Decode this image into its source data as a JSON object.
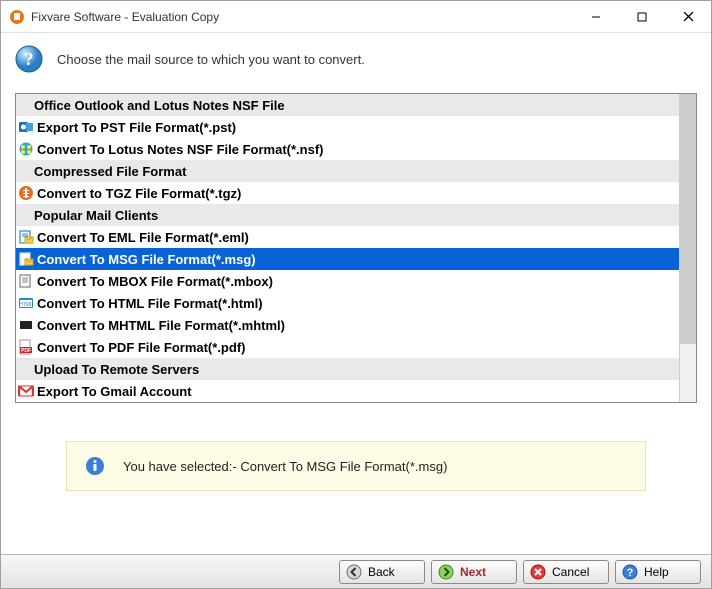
{
  "title": "Fixvare Software - Evaluation Copy",
  "header": "Choose the mail source to which you want to convert.",
  "sections": [
    {
      "type": "header",
      "label": "Office Outlook and Lotus Notes NSF File",
      "icon": "none"
    },
    {
      "type": "item",
      "label": "Export To PST File Format(*.pst)",
      "icon": "outlook"
    },
    {
      "type": "item",
      "label": "Convert To Lotus Notes NSF File Format(*.nsf)",
      "icon": "lotus"
    },
    {
      "type": "header",
      "label": "Compressed File Format",
      "icon": "none"
    },
    {
      "type": "item",
      "label": "Convert to TGZ File Format(*.tgz)",
      "icon": "tgz"
    },
    {
      "type": "header",
      "label": "Popular Mail Clients",
      "icon": "none"
    },
    {
      "type": "item",
      "label": "Convert To EML File Format(*.eml)",
      "icon": "eml"
    },
    {
      "type": "item",
      "label": "Convert To MSG File Format(*.msg)",
      "icon": "msg",
      "selected": true
    },
    {
      "type": "item",
      "label": "Convert To MBOX File Format(*.mbox)",
      "icon": "mbox"
    },
    {
      "type": "item",
      "label": "Convert To HTML File Format(*.html)",
      "icon": "html"
    },
    {
      "type": "item",
      "label": "Convert To MHTML File Format(*.mhtml)",
      "icon": "mhtml"
    },
    {
      "type": "item",
      "label": "Convert To PDF File Format(*.pdf)",
      "icon": "pdf"
    },
    {
      "type": "header",
      "label": "Upload To Remote Servers",
      "icon": "none"
    },
    {
      "type": "item",
      "label": "Export To Gmail Account",
      "icon": "gmail"
    }
  ],
  "info": {
    "text": "You have selected:- Convert To MSG File Format(*.msg)"
  },
  "footer": {
    "back": "Back",
    "next": "Next",
    "cancel": "Cancel",
    "help": "Help"
  }
}
